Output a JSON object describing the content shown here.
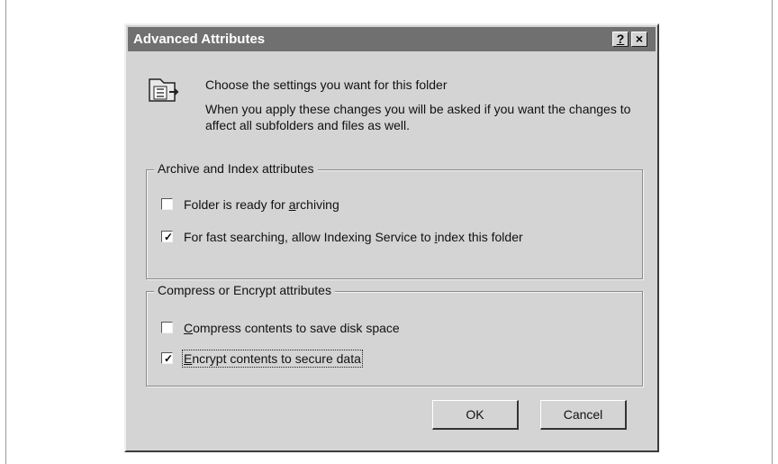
{
  "window": {
    "title": "Advanced Attributes",
    "help_label": "?",
    "close_label": "×"
  },
  "info": {
    "line1": "Choose the settings you want for this folder",
    "line2": "When you apply these changes you will be asked if you want the changes to affect all subfolders and files as well.",
    "icon": "folder-properties-icon"
  },
  "archive_group": {
    "legend": "Archive and Index attributes",
    "options": [
      {
        "label_pre": "Folder is ready for ",
        "label_key": "a",
        "label_post": "rchiving",
        "checked": false
      },
      {
        "label_pre": "For fast searching, allow Indexing Service to ",
        "label_key": "i",
        "label_post": "ndex this folder",
        "checked": true
      }
    ]
  },
  "compress_group": {
    "legend": "Compress or Encrypt attributes",
    "options": [
      {
        "label_pre": "",
        "label_key": "C",
        "label_post": "ompress contents to save disk space",
        "checked": false
      },
      {
        "label_pre": "",
        "label_key": "E",
        "label_post": "ncrypt contents to secure data",
        "checked": true
      }
    ]
  },
  "buttons": {
    "ok": "OK",
    "cancel": "Cancel"
  }
}
